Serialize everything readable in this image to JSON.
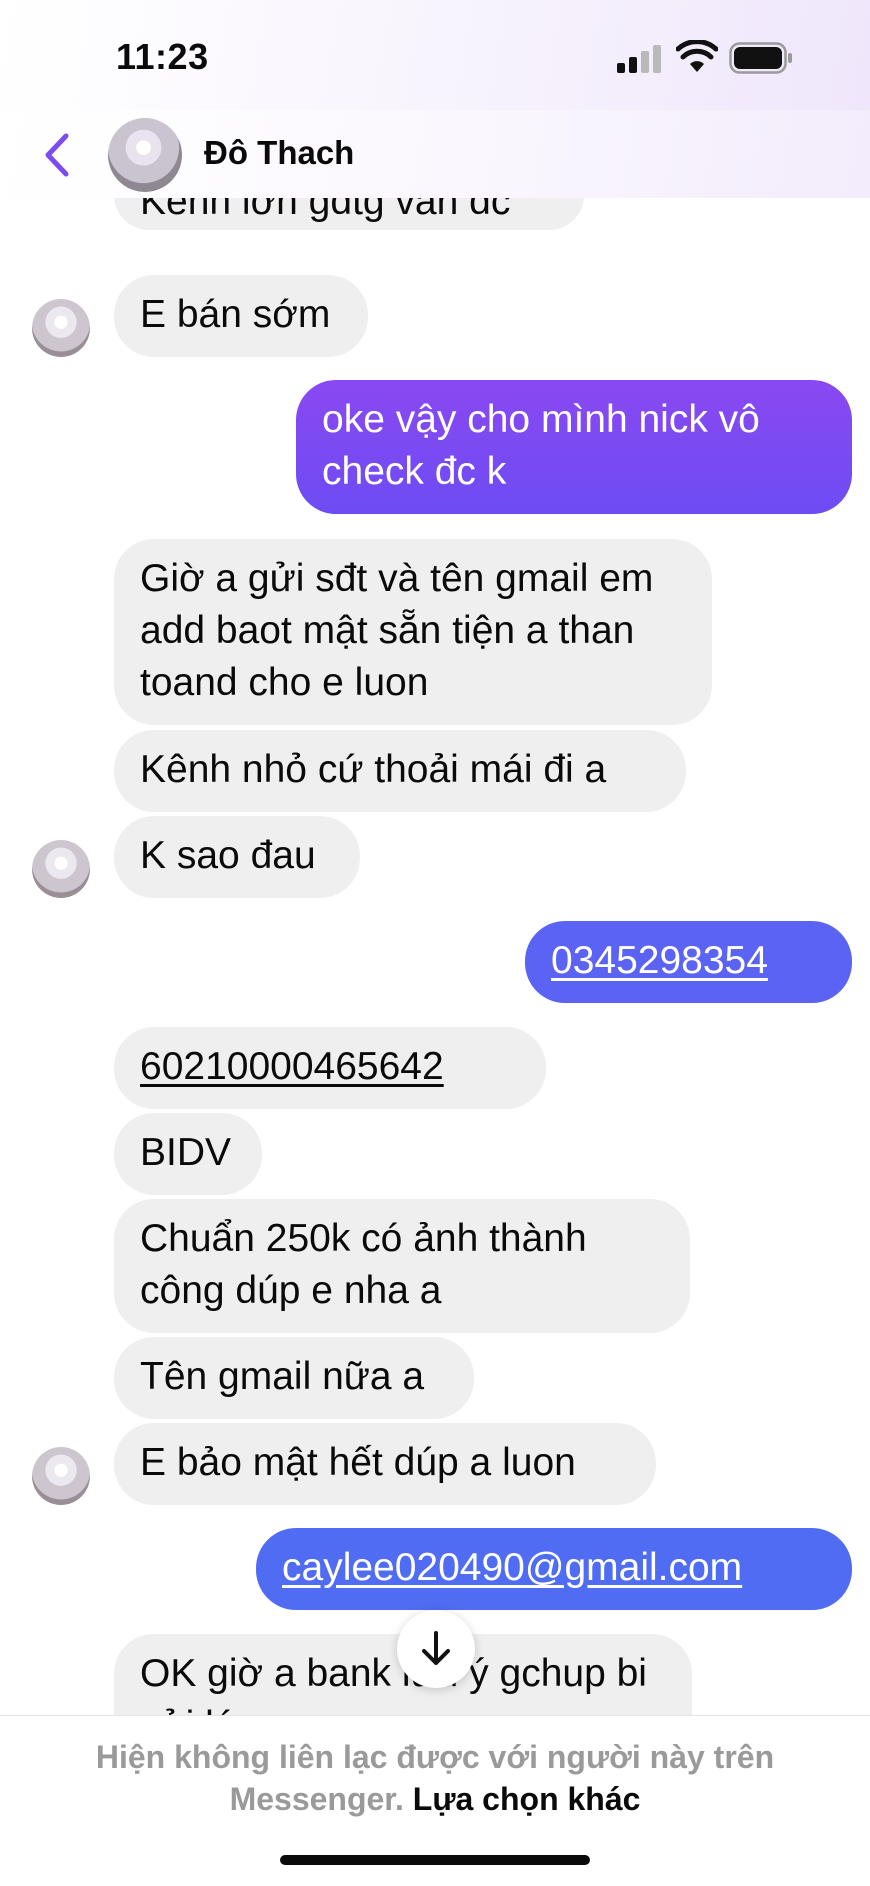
{
  "status_bar": {
    "time": "11:23"
  },
  "header": {
    "contact_name": "Đô Thach"
  },
  "messages": [
    {
      "side": "in",
      "text": "Kênh lớn gdtg vẫn dc"
    },
    {
      "side": "in",
      "text": "E bán sớm"
    },
    {
      "side": "out",
      "text": "oke vậy cho mình nick vô check đc k"
    },
    {
      "side": "in",
      "text": "Giờ a gửi sđt và tên gmail em add baot mật sẵn tiện a than toand cho e luon"
    },
    {
      "side": "in",
      "text": "Kênh nhỏ cứ thoải mái đi a"
    },
    {
      "side": "in",
      "text": "K sao đau"
    },
    {
      "side": "out",
      "text": "0345298354"
    },
    {
      "side": "in",
      "text": "60210000465642"
    },
    {
      "side": "in",
      "text": "BIDV"
    },
    {
      "side": "in",
      "text": "Chuẩn 250k có ảnh thành công dúp e nha a"
    },
    {
      "side": "in",
      "text": "Tên gmail nữa a"
    },
    {
      "side": "in",
      "text": "E bảo mật hết dúp a luon"
    },
    {
      "side": "out",
      "text": "caylee020490@gmail.com"
    },
    {
      "side": "in",
      "text": "OK giờ a bank lưu ý gchup bi xửi lá"
    }
  ],
  "footer": {
    "notice": "Hiện không liên lạc được với người này trên Messenger.",
    "action": "Lựa chọn khác"
  },
  "colors": {
    "accent_purple": "#7b4cf0",
    "accent_blue": "#5468f4",
    "incoming_bubble": "#efefef"
  },
  "icons": [
    "back-chevron-icon",
    "signal-icon",
    "wifi-icon",
    "battery-icon",
    "arrow-down-icon"
  ]
}
